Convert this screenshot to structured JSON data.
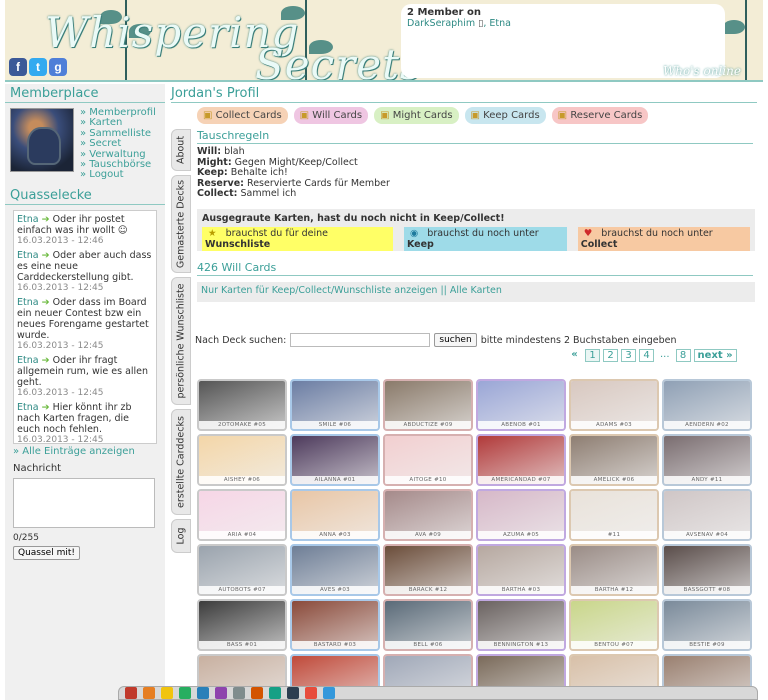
{
  "header": {
    "logo_line1": "Whispering",
    "logo_line2": "Secrets",
    "social": [
      "f",
      "t",
      "g"
    ],
    "online": {
      "title": "2 Member on",
      "user1": "DarkSeraphim",
      "user_sep": ",",
      "user2": "Etna",
      "device_icon": "phone-icon"
    },
    "whos_online": "Who's online"
  },
  "sidebar": {
    "memberplace_title": "Memberplace",
    "menu": [
      "Memberprofil",
      "Karten",
      "Sammelliste",
      "Secret",
      "Verwaltung",
      "Tauschbörse",
      "Logout"
    ],
    "quasselecke_title": "Quasselecke",
    "entries": [
      {
        "name": "Etna",
        "text": "Oder ihr postet einfach was ihr wollt",
        "date": "16.03.2013 - 12:46"
      },
      {
        "name": "Etna",
        "text": "Oder aber auch dass es eine neue Carddeckerstellung gibt.",
        "date": "16.03.2013 - 12:45"
      },
      {
        "name": "Etna",
        "text": "Oder dass im Board ein neuer Contest bzw ein neues Forengame gestartet wurde.",
        "date": "16.03.2013 - 12:45"
      },
      {
        "name": "Etna",
        "text": "Oder ihr fragt allgemein rum, wie es allen geht.",
        "date": "16.03.2013 - 12:45"
      },
      {
        "name": "Etna",
        "text": "Hier könnt ihr zb nach Karten fragen, die euch noch fehlen.",
        "date": "16.03.2013 - 12:45"
      }
    ],
    "all_entries": "» Alle Einträge anzeigen",
    "message_label": "Nachricht",
    "char_count": "0/255",
    "submit": "Quassel mit!"
  },
  "main": {
    "profile_title": "Jordan's Profil",
    "categories": [
      {
        "label": "Collect Cards",
        "color": "#f6d2b6"
      },
      {
        "label": "Will Cards",
        "color": "#efc6e2"
      },
      {
        "label": "Might Cards",
        "color": "#d8f0c4"
      },
      {
        "label": "Keep Cards",
        "color": "#c8e6ef"
      },
      {
        "label": "Reserve Cards",
        "color": "#f7c6c6"
      }
    ],
    "vtabs": [
      "About",
      "Gemasterte Decks",
      "persönliche Wunschliste",
      "erstellte Carddecks",
      "Log"
    ],
    "rules_title": "Tauschregeln",
    "rules": [
      {
        "k": "Will:",
        "v": "blah"
      },
      {
        "k": "Might:",
        "v": "Gegen Might/Keep/Collect"
      },
      {
        "k": "Keep:",
        "v": "Behalte ich!"
      },
      {
        "k": "Reserve:",
        "v": "Reservierte Cards für Member"
      },
      {
        "k": "Collect:",
        "v": "Sammel ich"
      }
    ],
    "gray_title": "Ausgegraute Karten, hast du noch nicht in Keep/Collect!",
    "legend": [
      {
        "pre": "brauchst du für deine",
        "bold": "Wunschliste",
        "bg": "#ffff66",
        "icon": "★"
      },
      {
        "pre": "brauchst du noch unter",
        "bold": "Keep",
        "bg": "#9edbe8",
        "icon": "◉"
      },
      {
        "pre": "brauchst du noch unter",
        "bold": "Collect",
        "bg": "#f7c9a2",
        "icon": "♥"
      }
    ],
    "count_title": "426 Will Cards",
    "filter_text": "Nur Karten für Keep/Collect/Wunschliste anzeigen || Alle Karten",
    "search_label": "Nach Deck suchen:",
    "search_button": "suchen",
    "search_hint": "bitte mindestens 2 Buchstaben eingeben",
    "pager": [
      "«",
      "1",
      "2",
      "3",
      "4",
      "...",
      "8",
      "next »"
    ],
    "cards": [
      {
        "name": "2OTOMAKE #05",
        "bg": "#555"
      },
      {
        "name": "SMILE #06",
        "bg": "#6b7da3"
      },
      {
        "name": "ABDUCTIZE #09",
        "bg": "#8a7a6a"
      },
      {
        "name": "ABENOB #01",
        "bg": "#9aa6d6"
      },
      {
        "name": "ADAMS #03",
        "bg": "#d8c8c0"
      },
      {
        "name": "AENDERN #02",
        "bg": "#8fa0b5"
      },
      {
        "name": "AISHEY #06",
        "bg": "#f3d6a8"
      },
      {
        "name": "AILANNA #01",
        "bg": "#4d3a5c"
      },
      {
        "name": "AITOGE #10",
        "bg": "#f2cfd0"
      },
      {
        "name": "AMERICANDAD #07",
        "bg": "#b13a3a"
      },
      {
        "name": "AMELICK #06",
        "bg": "#8e7e72"
      },
      {
        "name": "ANDY #11",
        "bg": "#7a6d70"
      },
      {
        "name": "ARIA #04",
        "bg": "#f6d6e6"
      },
      {
        "name": "ANNA #03",
        "bg": "#e8c6a6"
      },
      {
        "name": "AVA #09",
        "bg": "#a58a8a"
      },
      {
        "name": "AZUMA #05",
        "bg": "#d6b8c8"
      },
      {
        "name": "#11",
        "bg": "#e9e2da"
      },
      {
        "name": "AVSENAV #04",
        "bg": "#cfc6c6"
      },
      {
        "name": "AUTOBOTS #07",
        "bg": "#9aa3ad"
      },
      {
        "name": "AVES #03",
        "bg": "#6e7e96"
      },
      {
        "name": "BARACK #12",
        "bg": "#6b4d3a"
      },
      {
        "name": "BARTHA #03",
        "bg": "#b6a8a0"
      },
      {
        "name": "BARTHA #12",
        "bg": "#9a8c86"
      },
      {
        "name": "BASSGOTT #08",
        "bg": "#5a4d4a"
      },
      {
        "name": "BASS #01",
        "bg": "#3c3c3c"
      },
      {
        "name": "BASTARD #03",
        "bg": "#8a4a3a"
      },
      {
        "name": "BELL #06",
        "bg": "#5a6a78"
      },
      {
        "name": "BENNINGTON #13",
        "bg": "#6a6260"
      },
      {
        "name": "BENTOU #07",
        "bg": "#c9d68a"
      },
      {
        "name": "BESTIE #09",
        "bg": "#7a8a9a"
      },
      {
        "name": "#",
        "bg": "#c8b0a0"
      },
      {
        "name": "#",
        "bg": "#c04a3a"
      },
      {
        "name": "#",
        "bg": "#a0a8b8"
      },
      {
        "name": "#",
        "bg": "#7a6a5a"
      },
      {
        "name": "#",
        "bg": "#d8c0a8"
      },
      {
        "name": "#",
        "bg": "#9a8070"
      }
    ]
  }
}
